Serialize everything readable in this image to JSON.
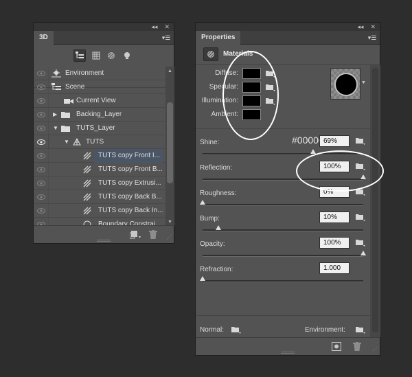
{
  "panel_3d": {
    "tab_label": "3D",
    "collapse_glyph": "◂◂",
    "close_glyph": "✕",
    "menu_glyph": "▾☰",
    "filter_icons": [
      "scene-filter-icon",
      "mesh-filter-icon",
      "material-filter-icon",
      "light-filter-icon"
    ],
    "layers": [
      {
        "label": "Environment",
        "icon": "environment-icon"
      },
      {
        "label": "Scene",
        "icon": "scene-icon"
      },
      {
        "label": "Current View",
        "icon": "camera-icon"
      },
      {
        "label": "Backing_Layer",
        "icon": "folder-icon",
        "twisty": "▶"
      },
      {
        "label": "TUTS_Layer",
        "icon": "folder-icon",
        "twisty": "▼"
      },
      {
        "label": "TUTS",
        "icon": "mesh-icon",
        "twisty": "▼"
      },
      {
        "label": "TUTS copy Front I...",
        "icon": "material-icon"
      },
      {
        "label": "TUTS copy Front B...",
        "icon": "material-icon"
      },
      {
        "label": "TUTS copy Extrusi...",
        "icon": "material-icon"
      },
      {
        "label": "TUTS copy Back B...",
        "icon": "material-icon"
      },
      {
        "label": "TUTS copy Back In...",
        "icon": "material-icon"
      },
      {
        "label": "Boundary Constrai...",
        "icon": "constraint-icon"
      }
    ],
    "footer_icons": [
      "new-object-icon",
      "trash-icon"
    ]
  },
  "panel_properties": {
    "tab_label": "Properties",
    "collapse_glyph": "◂◂",
    "close_glyph": "✕",
    "menu_glyph": "▾☰",
    "header_title": "Materials",
    "colors": [
      {
        "label": "Diffuse:",
        "value": "#000000"
      },
      {
        "label": "Specular:",
        "value": "#000000"
      },
      {
        "label": "Illumination:",
        "value": "#000000"
      },
      {
        "label": "Ambient:",
        "value": "#000000"
      }
    ],
    "hex_readout": "#000000",
    "sliders": [
      {
        "label": "Shine:",
        "value": "69%",
        "level": 0.69,
        "has_folder": true
      },
      {
        "label": "Reflection:",
        "value": "100%",
        "level": 1.0,
        "has_folder": true
      },
      {
        "label": "Roughness:",
        "value": "0%",
        "level": 0.0,
        "has_folder": true
      },
      {
        "label": "Bump:",
        "value": "10%",
        "level": 0.1,
        "has_folder": true
      },
      {
        "label": "Opacity:",
        "value": "100%",
        "level": 1.0,
        "has_folder": true
      },
      {
        "label": "Refraction:",
        "value": "1.000",
        "level": 0.0,
        "has_folder": false
      }
    ],
    "texture_normal_label": "Normal:",
    "texture_environment_label": "Environment:",
    "footer_icons": [
      "load-preset-icon",
      "trash-icon"
    ]
  },
  "annotation_color": "#ffffff"
}
